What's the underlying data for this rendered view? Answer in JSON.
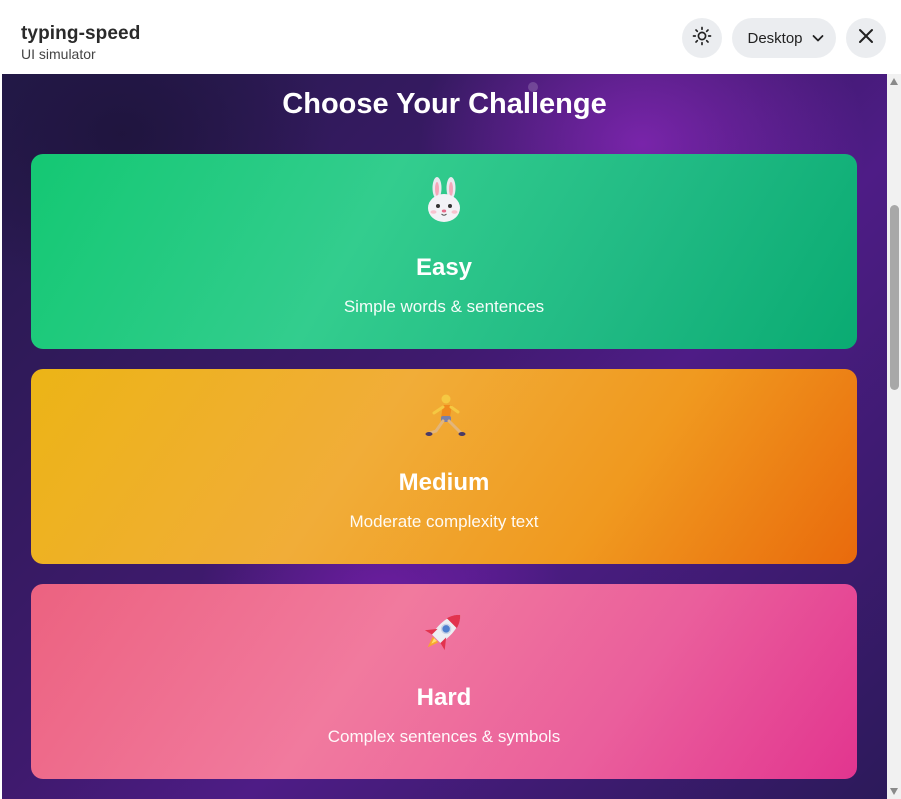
{
  "app": {
    "name": "typing-speed",
    "subtitle": "UI simulator"
  },
  "toolbar": {
    "theme_icon": "sun-icon",
    "device_label": "Desktop",
    "device_icon": "chevron-down-icon",
    "close_icon": "close-icon"
  },
  "main": {
    "heading": "Choose Your Challenge",
    "cards": [
      {
        "icon": "rabbit-face-icon",
        "title": "Easy",
        "description": "Simple words & sentences",
        "color": "#14c873"
      },
      {
        "icon": "person-running-icon",
        "title": "Medium",
        "description": "Moderate complexity text",
        "color": "#f0a020"
      },
      {
        "icon": "rocket-icon",
        "title": "Hard",
        "description": "Complex sentences & symbols",
        "color": "#ea5f9c"
      }
    ]
  },
  "colors": {
    "background": "#3f1a6e",
    "titlebar": "#ffffff"
  }
}
